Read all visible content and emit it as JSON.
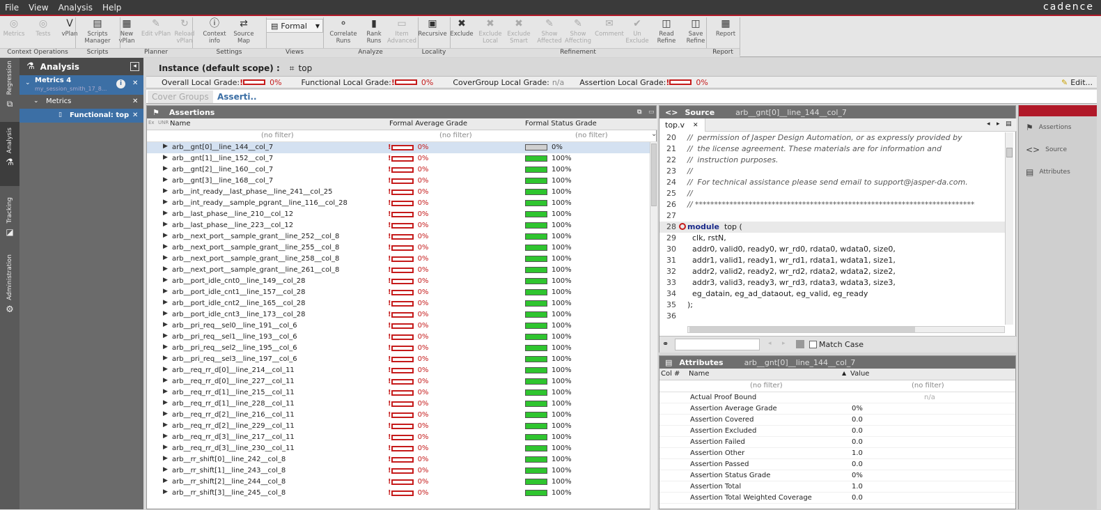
{
  "menu": [
    "File",
    "View",
    "Analysis",
    "Help"
  ],
  "brand": "cadence",
  "toolbar": {
    "buttons": [
      {
        "label": "Metrics",
        "icon": "metrics-icon",
        "glyph": "◎",
        "disabled": true
      },
      {
        "label": "Tests",
        "icon": "tests-icon",
        "glyph": "◎",
        "disabled": true
      },
      {
        "label": "vPlan",
        "icon": "vplan-icon",
        "glyph": "V",
        "disabled": false
      },
      {
        "label": "Scripts Manager",
        "icon": "scripts-icon",
        "glyph": "▤",
        "disabled": false
      },
      {
        "label": "New vPlan",
        "icon": "new-vplan-icon",
        "glyph": "▦",
        "disabled": false
      },
      {
        "label": "Edit vPlan",
        "icon": "edit-vplan-icon",
        "glyph": "✎",
        "disabled": true
      },
      {
        "label": "Reload vPlan",
        "icon": "reload-vplan-icon",
        "glyph": "↻",
        "disabled": true
      },
      {
        "label": "Context info",
        "icon": "info-icon",
        "glyph": "ⓘ",
        "disabled": false
      },
      {
        "label": "Source Map",
        "icon": "source-map-icon",
        "glyph": "⇄",
        "disabled": false
      },
      {
        "label": "Correlate Runs",
        "icon": "correlate-icon",
        "glyph": "⚬",
        "disabled": false
      },
      {
        "label": "Rank Runs",
        "icon": "rank-icon",
        "glyph": "▮",
        "disabled": false
      },
      {
        "label": "Item Advanced",
        "icon": "item-advanced-icon",
        "glyph": "▭",
        "disabled": true
      },
      {
        "label": "Recursive",
        "icon": "recursive-icon",
        "glyph": "▣",
        "disabled": false
      },
      {
        "label": "Exclude",
        "icon": "exclude-icon",
        "glyph": "✖",
        "disabled": false
      },
      {
        "label": "Exclude Local",
        "icon": "exclude-local-icon",
        "glyph": "✖",
        "disabled": true
      },
      {
        "label": "Exclude Smart",
        "icon": "exclude-smart-icon",
        "glyph": "✖",
        "disabled": true
      },
      {
        "label": "Show Affected",
        "icon": "show-affected-icon",
        "glyph": "✎",
        "disabled": true
      },
      {
        "label": "Show Affecting",
        "icon": "show-affecting-icon",
        "glyph": "✎",
        "disabled": true
      },
      {
        "label": "Comment",
        "icon": "comment-icon",
        "glyph": "✉",
        "disabled": true
      },
      {
        "label": "Un Exclude",
        "icon": "unexclude-icon",
        "glyph": "✔",
        "disabled": true
      },
      {
        "label": "Read Refine",
        "icon": "read-refine-icon",
        "glyph": "◫",
        "disabled": false
      },
      {
        "label": "Save Refine",
        "icon": "save-refine-icon",
        "glyph": "◫",
        "disabled": false
      },
      {
        "label": "Report",
        "icon": "report-icon",
        "glyph": "▦",
        "disabled": false
      }
    ],
    "formal_select": "Formal",
    "groups": [
      "Context Operations",
      "Scripts",
      "Planner",
      "Settings",
      "Views",
      "Analyze",
      "Locality",
      "Refinement",
      "Report"
    ]
  },
  "sidetabs": [
    "Regression",
    "Analysis",
    "Tracking",
    "Administration"
  ],
  "nav": {
    "title": "Analysis",
    "session": "Metrics 4",
    "session_sub": "my_session_smith_17_8...",
    "metrics": "Metrics",
    "functional": "Functional: top"
  },
  "instance": {
    "label": "Instance (default scope) :",
    "value": "top"
  },
  "grades": {
    "overall_label": "Overall Local Grade:",
    "overall": "0%",
    "functional_label": "Functional Local Grade:",
    "functional": "0%",
    "covergroup_label": "CoverGroup Local Grade:",
    "covergroup": "n/a",
    "assertion_label": "Assertion Local Grade:",
    "assertion": "0%",
    "edit": "Edit..."
  },
  "subtabs": [
    "Cover Groups",
    "Asserti.."
  ],
  "assertions": {
    "title": "Assertions",
    "columns": [
      "Ex",
      "UNR",
      "Name",
      "Formal Average Grade",
      "Formal Status Grade"
    ],
    "filter": "(no filter)",
    "rows": [
      {
        "name": "arb__gnt[0]__line_144__col_7",
        "avg": "0%",
        "status": "0%"
      },
      {
        "name": "arb__gnt[1]__line_152__col_7",
        "avg": "0%",
        "status": "100%"
      },
      {
        "name": "arb__gnt[2]__line_160__col_7",
        "avg": "0%",
        "status": "100%"
      },
      {
        "name": "arb__gnt[3]__line_168__col_7",
        "avg": "0%",
        "status": "100%"
      },
      {
        "name": "arb__int_ready__last_phase__line_241__col_25",
        "avg": "0%",
        "status": "100%"
      },
      {
        "name": "arb__int_ready__sample_pgrant__line_116__col_28",
        "avg": "0%",
        "status": "100%"
      },
      {
        "name": "arb__last_phase__line_210__col_12",
        "avg": "0%",
        "status": "100%"
      },
      {
        "name": "arb__last_phase__line_223__col_12",
        "avg": "0%",
        "status": "100%"
      },
      {
        "name": "arb__next_port__sample_grant__line_252__col_8",
        "avg": "0%",
        "status": "100%"
      },
      {
        "name": "arb__next_port__sample_grant__line_255__col_8",
        "avg": "0%",
        "status": "100%"
      },
      {
        "name": "arb__next_port__sample_grant__line_258__col_8",
        "avg": "0%",
        "status": "100%"
      },
      {
        "name": "arb__next_port__sample_grant__line_261__col_8",
        "avg": "0%",
        "status": "100%"
      },
      {
        "name": "arb__port_idle_cnt0__line_149__col_28",
        "avg": "0%",
        "status": "100%"
      },
      {
        "name": "arb__port_idle_cnt1__line_157__col_28",
        "avg": "0%",
        "status": "100%"
      },
      {
        "name": "arb__port_idle_cnt2__line_165__col_28",
        "avg": "0%",
        "status": "100%"
      },
      {
        "name": "arb__port_idle_cnt3__line_173__col_28",
        "avg": "0%",
        "status": "100%"
      },
      {
        "name": "arb__pri_req__sel0__line_191__col_6",
        "avg": "0%",
        "status": "100%"
      },
      {
        "name": "arb__pri_req__sel1__line_193__col_6",
        "avg": "0%",
        "status": "100%"
      },
      {
        "name": "arb__pri_req__sel2__line_195__col_6",
        "avg": "0%",
        "status": "100%"
      },
      {
        "name": "arb__pri_req__sel3__line_197__col_6",
        "avg": "0%",
        "status": "100%"
      },
      {
        "name": "arb__req_rr_d[0]__line_214__col_11",
        "avg": "0%",
        "status": "100%"
      },
      {
        "name": "arb__req_rr_d[0]__line_227__col_11",
        "avg": "0%",
        "status": "100%"
      },
      {
        "name": "arb__req_rr_d[1]__line_215__col_11",
        "avg": "0%",
        "status": "100%"
      },
      {
        "name": "arb__req_rr_d[1]__line_228__col_11",
        "avg": "0%",
        "status": "100%"
      },
      {
        "name": "arb__req_rr_d[2]__line_216__col_11",
        "avg": "0%",
        "status": "100%"
      },
      {
        "name": "arb__req_rr_d[2]__line_229__col_11",
        "avg": "0%",
        "status": "100%"
      },
      {
        "name": "arb__req_rr_d[3]__line_217__col_11",
        "avg": "0%",
        "status": "100%"
      },
      {
        "name": "arb__req_rr_d[3]__line_230__col_11",
        "avg": "0%",
        "status": "100%"
      },
      {
        "name": "arb__rr_shift[0]__line_242__col_8",
        "avg": "0%",
        "status": "100%"
      },
      {
        "name": "arb__rr_shift[1]__line_243__col_8",
        "avg": "0%",
        "status": "100%"
      },
      {
        "name": "arb__rr_shift[2]__line_244__col_8",
        "avg": "0%",
        "status": "100%"
      },
      {
        "name": "arb__rr_shift[3]__line_245__col_8",
        "avg": "0%",
        "status": "100%"
      }
    ]
  },
  "source": {
    "title": "Source",
    "context": "arb__gnt[0]__line_144__col_7",
    "file_tab": "top.v",
    "lines": [
      {
        "n": "20",
        "t": "//  permission of Jasper Design Automation, or as expressly provided by",
        "c": true
      },
      {
        "n": "21",
        "t": "//  the license agreement. These materials are for information and",
        "c": true
      },
      {
        "n": "22",
        "t": "//  instruction purposes.",
        "c": true
      },
      {
        "n": "23",
        "t": "//",
        "c": true
      },
      {
        "n": "24",
        "t": "//  For technical assistance please send email to support@jasper-da.com.",
        "c": true
      },
      {
        "n": "25",
        "t": "//",
        "c": true
      },
      {
        "n": "26",
        "t": "// *************************************************************************",
        "c": true
      },
      {
        "n": "27",
        "t": "",
        "c": false
      },
      {
        "n": "28",
        "t": "top (",
        "c": false,
        "kw": "module"
      },
      {
        "n": "29",
        "t": "  clk, rstN,",
        "c": false
      },
      {
        "n": "30",
        "t": "  addr0, valid0, ready0, wr_rd0, rdata0, wdata0, size0,",
        "c": false
      },
      {
        "n": "31",
        "t": "  addr1, valid1, ready1, wr_rd1, rdata1, wdata1, size1,",
        "c": false
      },
      {
        "n": "32",
        "t": "  addr2, valid2, ready2, wr_rd2, rdata2, wdata2, size2,",
        "c": false
      },
      {
        "n": "33",
        "t": "  addr3, valid3, ready3, wr_rd3, rdata3, wdata3, size3,",
        "c": false
      },
      {
        "n": "34",
        "t": "  eg_datain, eg_ad_dataout, eg_valid, eg_ready",
        "c": false
      },
      {
        "n": "35",
        "t": ");",
        "c": false
      },
      {
        "n": "36",
        "t": "",
        "c": false
      }
    ],
    "find_value": "",
    "match_case": "Match Case"
  },
  "attributes": {
    "title": "Attributes",
    "context": "arb__gnt[0]__line_144__col_7",
    "columns": [
      "Col #",
      "Name",
      "Value"
    ],
    "filter": "(no filter)",
    "rows": [
      {
        "name": "Actual Proof Bound",
        "value": "n/a"
      },
      {
        "name": "Assertion Average Grade",
        "value": "0%"
      },
      {
        "name": "Assertion Covered",
        "value": "0.0"
      },
      {
        "name": "Assertion Excluded",
        "value": "0.0"
      },
      {
        "name": "Assertion Failed",
        "value": "0.0"
      },
      {
        "name": "Assertion Other",
        "value": "1.0"
      },
      {
        "name": "Assertion Passed",
        "value": "0.0"
      },
      {
        "name": "Assertion Status Grade",
        "value": "0%"
      },
      {
        "name": "Assertion Total",
        "value": "1.0"
      },
      {
        "name": "Assertion Total Weighted Coverage",
        "value": "0.0"
      }
    ]
  },
  "dock": [
    "Assertions",
    "Source",
    "Attributes"
  ],
  "colors": {
    "accent_red": "#b01828",
    "grade_green": "#2fc52f",
    "grade_red": "#c51a1a",
    "select_blue": "#3c6fa5"
  }
}
